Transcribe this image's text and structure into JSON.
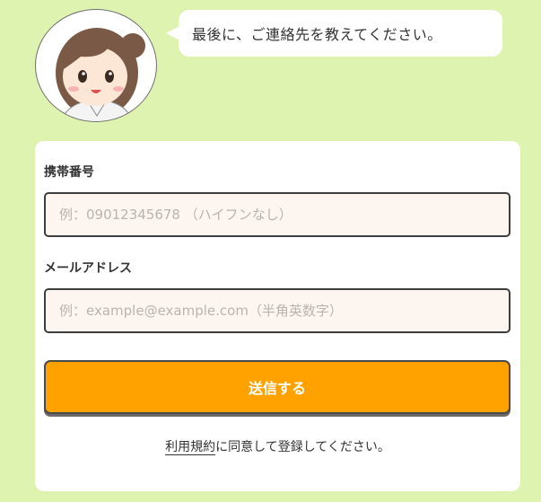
{
  "chat": {
    "message": "最後に、ご連絡先を教えてください。",
    "avatar_icon": "nurse-avatar-icon"
  },
  "form": {
    "phone_label": "携帯番号",
    "phone_placeholder": "例：09012345678 （ハイフンなし）",
    "phone_value": "",
    "email_label": "メールアドレス",
    "email_placeholder": "例：example@example.com（半角英数字）",
    "email_value": "",
    "submit_label": "送信する",
    "terms_link": "利用規約",
    "terms_suffix": "に同意して登録してください。"
  },
  "colors": {
    "background": "#dff3b0",
    "accent": "#ffa200",
    "input_bg": "#fdf5f0"
  }
}
